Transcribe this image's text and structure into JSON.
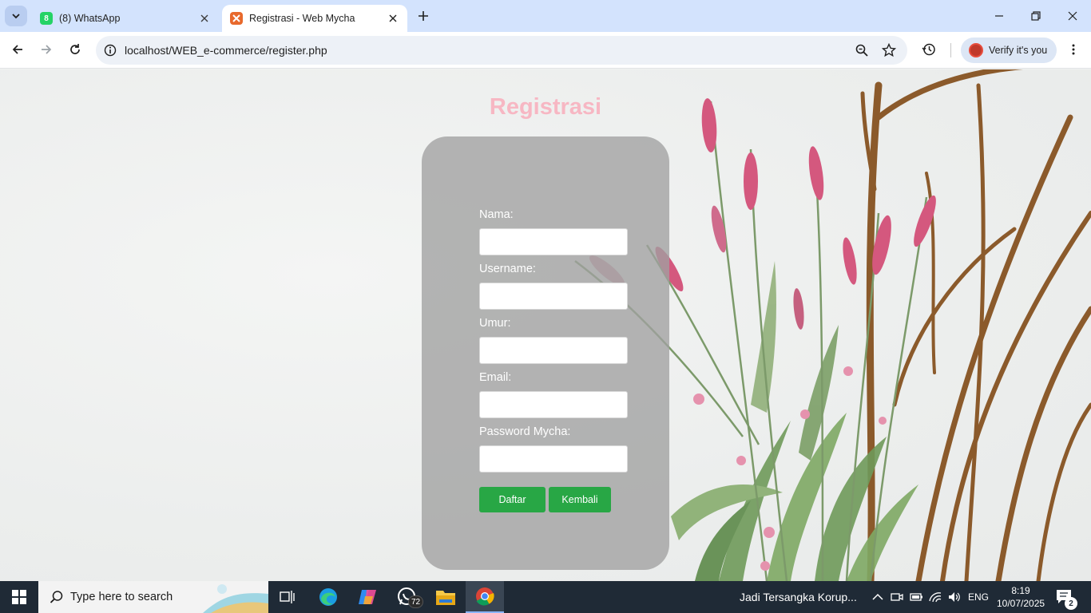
{
  "browser": {
    "tabs": [
      {
        "title": "(8) WhatsApp",
        "favicon_badge": "8",
        "active": false
      },
      {
        "title": "Registrasi - Web Mycha",
        "active": true
      }
    ],
    "url": "localhost/WEB_e-commerce/register.php",
    "verify_label": "Verify it's you"
  },
  "page": {
    "title": "Registrasi",
    "form": {
      "fields": [
        {
          "label": "Nama:",
          "value": ""
        },
        {
          "label": "Username:",
          "value": ""
        },
        {
          "label": "Umur:",
          "value": ""
        },
        {
          "label": "Email:",
          "value": ""
        },
        {
          "label": "Password Mycha:",
          "value": ""
        }
      ],
      "buttons": {
        "submit": "Daftar",
        "back": "Kembali"
      }
    },
    "colors": {
      "title": "#f7b7c3",
      "button": "#28a745",
      "card": "#a0a0a0"
    }
  },
  "taskbar": {
    "search_placeholder": "Type here to search",
    "whatsapp_badge": "72",
    "news": "Jadi Tersangka Korup...",
    "language": "ENG",
    "time": "8:19",
    "date": "10/07/2025",
    "notification_count": "2"
  }
}
